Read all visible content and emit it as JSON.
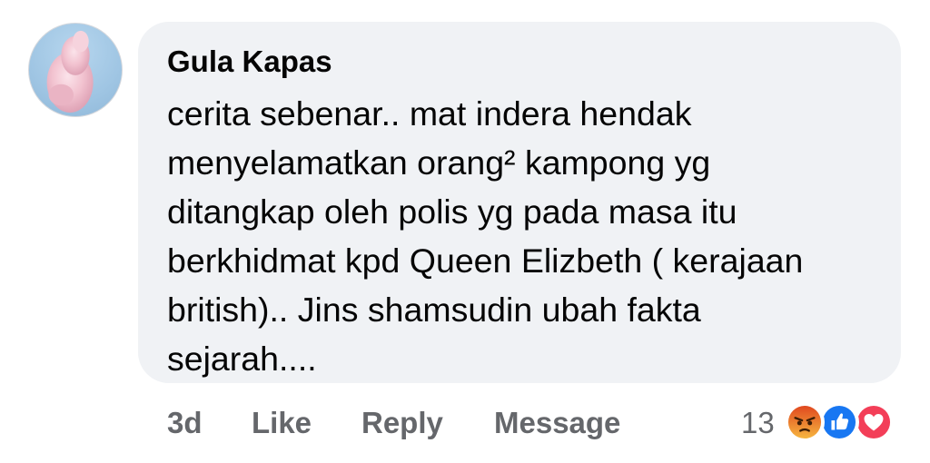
{
  "comment": {
    "author": "Gula Kapas",
    "text_lines": [
      "cerita sebenar.. mat indera hendak",
      "menyelamatkan orang² kampong yg",
      "ditangkap oleh polis yg pada masa itu",
      "berkhidmat kpd Queen Elizbeth ( kerajaan",
      "british).. Jins shamsudin ubah fakta",
      "sejarah...."
    ],
    "avatar_icon": "cotton-candy-avatar"
  },
  "actions": {
    "time": "3d",
    "like_label": "Like",
    "reply_label": "Reply",
    "message_label": "Message"
  },
  "reactions": {
    "count": "13",
    "icons": [
      "angry-reaction-icon",
      "like-reaction-icon",
      "love-reaction-icon"
    ]
  },
  "colors": {
    "bubble_bg": "#f0f2f5",
    "text_primary": "#050505",
    "text_secondary": "#65676b",
    "like_blue": "#1877f2",
    "love_red": "#f33e58",
    "angry_orange": "#e9710f"
  }
}
